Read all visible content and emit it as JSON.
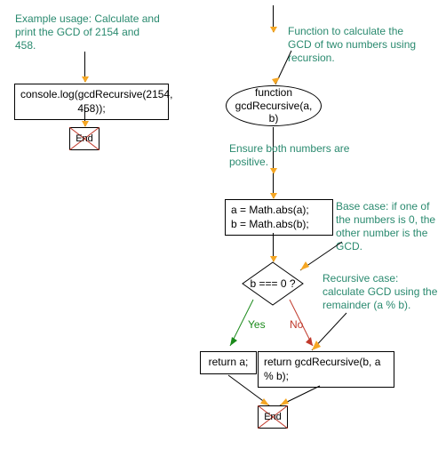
{
  "notes": {
    "example": "Example usage: Calculate and print the GCD of 2154 and 458.",
    "funcDesc": "Function to calculate the GCD of two numbers using recursion.",
    "ensurePos": "Ensure both numbers are positive.",
    "baseCase": "Base case: if one of the numbers is 0, the other number is the GCD.",
    "recursive": "Recursive case: calculate GCD using the remainder (a % b)."
  },
  "nodes": {
    "consoleLog": "console.log(gcdRecursive(2154, 458));",
    "funcDecl": "function gcdRecursive(a, b)",
    "abs": "a = Math.abs(a);\nb = Math.abs(b);",
    "cond": "b === 0 ?",
    "retA": "return a;",
    "retRec": "return gcdRecursive(b, a % b);",
    "end": "End"
  },
  "branches": {
    "yes": "Yes",
    "no": "No"
  }
}
